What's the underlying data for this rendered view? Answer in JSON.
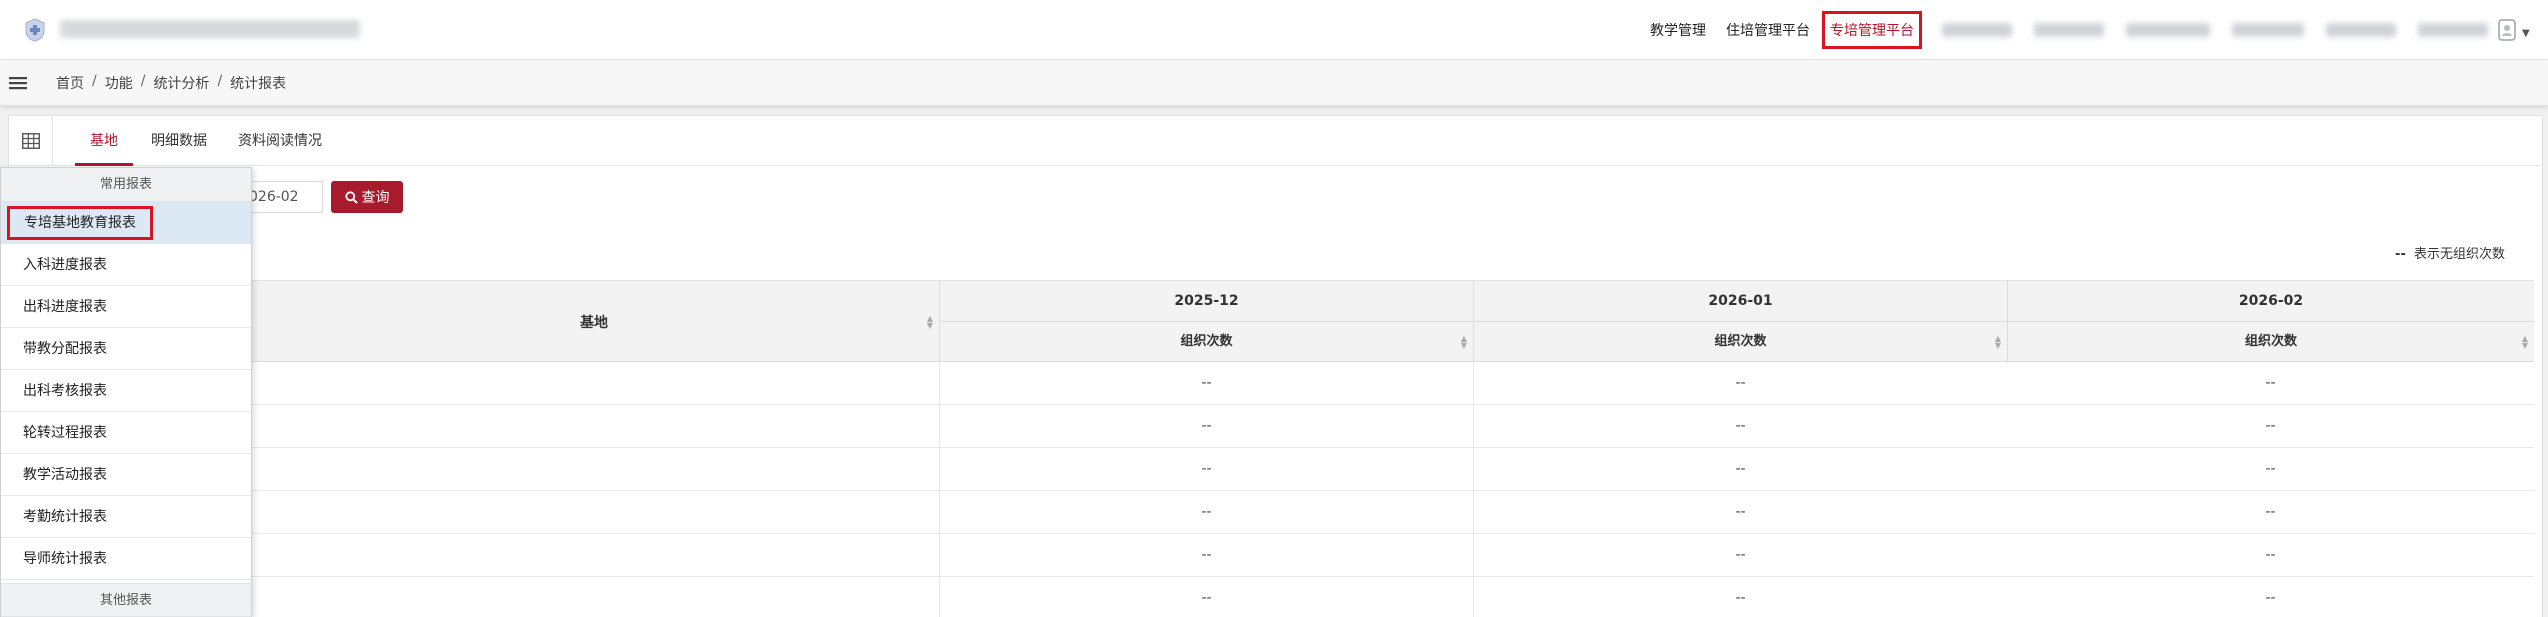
{
  "header": {
    "nav": [
      {
        "label": "教学管理",
        "active": false
      },
      {
        "label": "住培管理平台",
        "active": false
      },
      {
        "label": "专培管理平台",
        "active": true
      }
    ],
    "accent_color": "#b0162b"
  },
  "breadcrumb": [
    "首页",
    "功能",
    "统计分析",
    "统计报表"
  ],
  "tabs": [
    {
      "label": "基地",
      "active": true
    },
    {
      "label": "明细数据",
      "active": false
    },
    {
      "label": "资料阅读情况",
      "active": false
    }
  ],
  "query": {
    "date_value": "026-02",
    "button_label": "查询"
  },
  "legend_note": {
    "mark": "--",
    "text": "表示无组织次数"
  },
  "table": {
    "base_header": "基地",
    "months": [
      "2025-12",
      "2026-01",
      "2026-02"
    ],
    "sub_header": "组织次数",
    "rows": [
      [
        "",
        "--",
        "--",
        "--"
      ],
      [
        "",
        "--",
        "--",
        "--"
      ],
      [
        "",
        "--",
        "--",
        "--"
      ],
      [
        "",
        "--",
        "--",
        "--"
      ],
      [
        "",
        "--",
        "--",
        "--"
      ],
      [
        "",
        "--",
        "--",
        "--"
      ]
    ]
  },
  "report_menu": {
    "group_top": "常用报表",
    "items": [
      {
        "label": "专培基地教育报表",
        "selected": true
      },
      {
        "label": "入科进度报表",
        "selected": false
      },
      {
        "label": "出科进度报表",
        "selected": false
      },
      {
        "label": "带教分配报表",
        "selected": false
      },
      {
        "label": "出科考核报表",
        "selected": false
      },
      {
        "label": "轮转过程报表",
        "selected": false
      },
      {
        "label": "教学活动报表",
        "selected": false
      },
      {
        "label": "考勤统计报表",
        "selected": false
      },
      {
        "label": "导师统计报表",
        "selected": false
      }
    ],
    "group_bottom": "其他报表"
  }
}
